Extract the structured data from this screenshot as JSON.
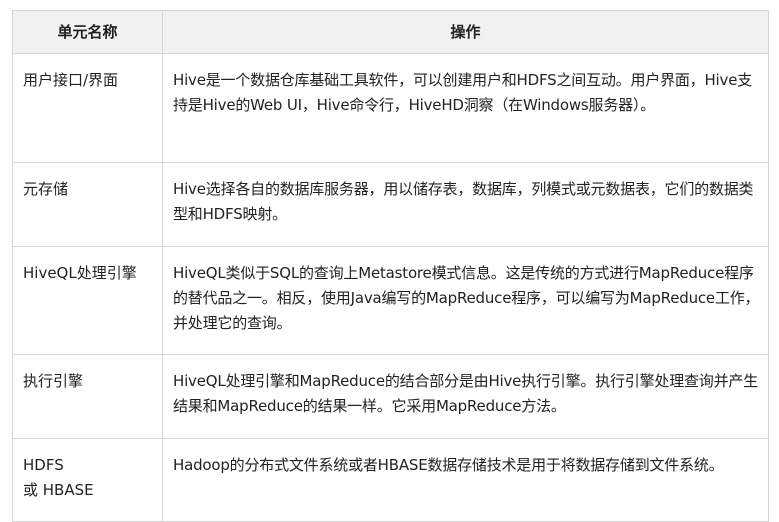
{
  "table": {
    "headers": [
      "单元名称",
      "操作"
    ],
    "rows": [
      {
        "unit": "用户接口/界面",
        "operation": "Hive是一个数据仓库基础工具软件，可以创建用户和HDFS之间互动。用户界面，Hive支持是Hive的Web UI，Hive命令行，HiveHD洞察（在Windows服务器）。"
      },
      {
        "unit": "元存储",
        "operation": "Hive选择各自的数据库服务器，用以储存表，数据库，列模式或元数据表，它们的数据类型和HDFS映射。"
      },
      {
        "unit": "HiveQL处理引擎",
        "operation": "HiveQL类似于SQL的查询上Metastore模式信息。这是传统的方式进行MapReduce程序的替代品之一。相反，使用Java编写的MapReduce程序，可以编写为MapReduce工作，并处理它的查询。"
      },
      {
        "unit": "执行引擎",
        "operation": "HiveQL处理引擎和MapReduce的结合部分是由Hive执行引擎。执行引擎处理查询并产生结果和MapReduce的结果一样。它采用MapReduce方法。"
      },
      {
        "unit": "HDFS\n或 HBASE",
        "operation": "Hadoop的分布式文件系统或者HBASE数据存储技术是用于将数据存储到文件系统。"
      }
    ]
  }
}
